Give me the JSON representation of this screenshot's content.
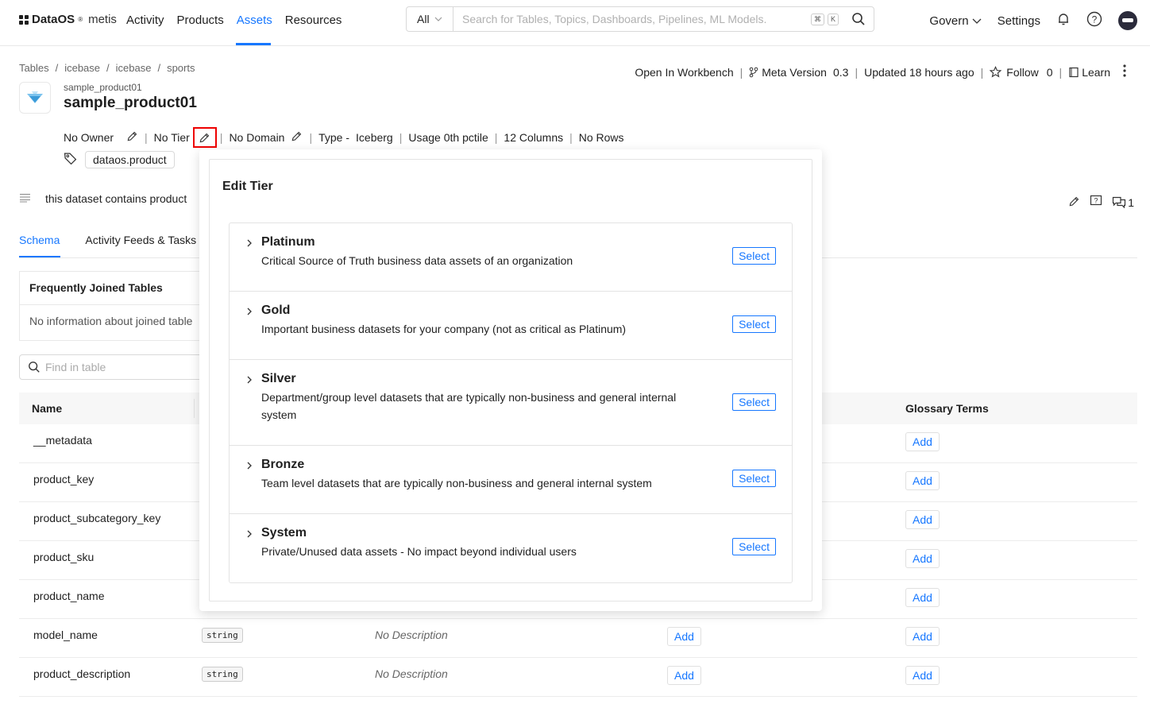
{
  "app": {
    "brand": "DataOS",
    "brand_suffix": "metis",
    "registered": "®"
  },
  "nav": {
    "items": [
      {
        "label": "Activity"
      },
      {
        "label": "Products"
      },
      {
        "label": "Assets"
      },
      {
        "label": "Resources"
      }
    ],
    "active": "Assets"
  },
  "search": {
    "scope": "All",
    "placeholder": "Search for Tables, Topics, Dashboards, Pipelines, ML Models.",
    "shortcut_1": "⌘",
    "shortcut_2": "K"
  },
  "rightnav": {
    "govern": "Govern",
    "settings": "Settings"
  },
  "breadcrumb": [
    "Tables",
    "icebase",
    "icebase",
    "sports"
  ],
  "entity": {
    "subtitle": "sample_product01",
    "title": "sample_product01"
  },
  "header_actions": {
    "workbench": "Open In Workbench",
    "meta_version_label": "Meta Version",
    "meta_version": "0.3",
    "updated": "Updated 18 hours ago",
    "follow_label": "Follow",
    "follow_count": "0",
    "learn": "Learn"
  },
  "meta": {
    "owner": "No Owner",
    "tier": "No Tier",
    "domain": "No Domain",
    "type_label": "Type -",
    "type_value": "Iceberg",
    "usage": "Usage 0th pctile",
    "columns": "12 Columns",
    "rows": "No Rows"
  },
  "tag": "dataos.product",
  "description": "this dataset contains product",
  "conversation_count": "1",
  "tabs": [
    {
      "label": "Schema"
    },
    {
      "label": "Activity Feeds & Tasks"
    }
  ],
  "joined": {
    "title": "Frequently Joined Tables",
    "empty": "No information about joined table"
  },
  "find_placeholder": "Find in table",
  "table": {
    "headers": {
      "name": "Name",
      "glossary": "Glossary Terms"
    },
    "add_label": "Add",
    "no_description": "No Description",
    "rows": [
      {
        "name": "__metadata"
      },
      {
        "name": "product_key"
      },
      {
        "name": "product_subcategory_key"
      },
      {
        "name": "product_sku"
      },
      {
        "name": "product_name"
      },
      {
        "name": "model_name",
        "type": "string"
      },
      {
        "name": "product_description",
        "type": "string"
      }
    ]
  },
  "edit_tier": {
    "title": "Edit Tier",
    "select_label": "Select",
    "tiers": [
      {
        "name": "Platinum",
        "description": "Critical Source of Truth business data assets of an organization"
      },
      {
        "name": "Gold",
        "description": "Important business datasets for your company (not as critical as Platinum)"
      },
      {
        "name": "Silver",
        "description": "Department/group level datasets that are typically non-business and general internal system"
      },
      {
        "name": "Bronze",
        "description": "Team level datasets that are typically non-business and general internal system"
      },
      {
        "name": "System",
        "description": "Private/Unused data assets - No impact beyond individual users"
      }
    ]
  },
  "colors": {
    "accent": "#1677ff",
    "highlight": "#e00000"
  }
}
